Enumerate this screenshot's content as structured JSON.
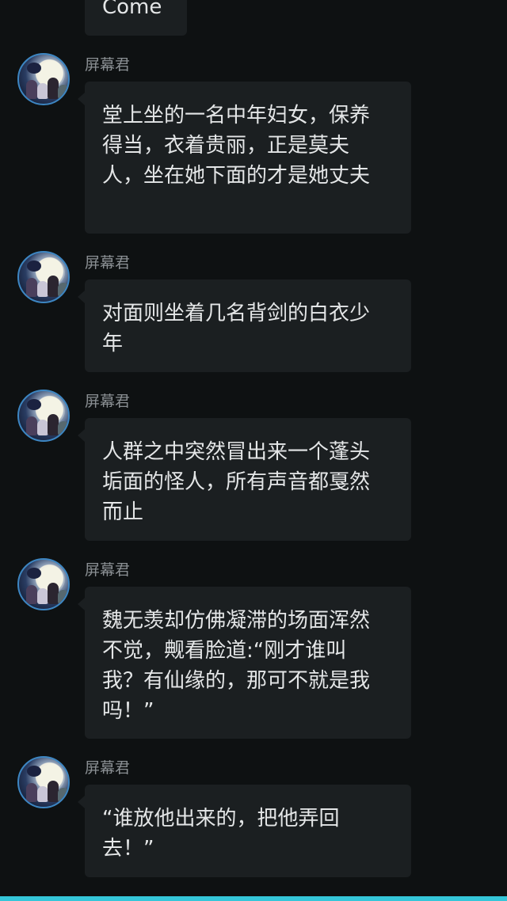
{
  "theme": {
    "background": "#0e1112",
    "bubble": "#1b1f21",
    "text": "#e4e6e7",
    "sender": "#8a8f93",
    "avatar_ring": "#3d86c2",
    "bottom_bar": "#35c6d9"
  },
  "messages": [
    {
      "text": "Come"
    },
    {
      "sender": "屏幕君",
      "avatar": "anime-moon-avatar-icon",
      "text": "堂上坐的一名中年妇女，保养得当，衣着贵丽，正是莫夫人，坐在她下面的才是她丈夫"
    },
    {
      "sender": "屏幕君",
      "avatar": "anime-moon-avatar-icon",
      "text": "对面则坐着几名背剑的白衣少年"
    },
    {
      "sender": "屏幕君",
      "avatar": "anime-moon-avatar-icon",
      "text": "人群之中突然冒出来一个蓬头垢面的怪人，所有声音都戛然而止"
    },
    {
      "sender": "屏幕君",
      "avatar": "anime-moon-avatar-icon",
      "text": "魏无羡却仿佛凝滞的场面浑然不觉，觍看脸道:“刚才谁叫我？有仙缘的，那可不就是我吗！”"
    },
    {
      "sender": "屏幕君",
      "avatar": "anime-moon-avatar-icon",
      "text": "“谁放他出来的，把他弄回去！”"
    }
  ]
}
